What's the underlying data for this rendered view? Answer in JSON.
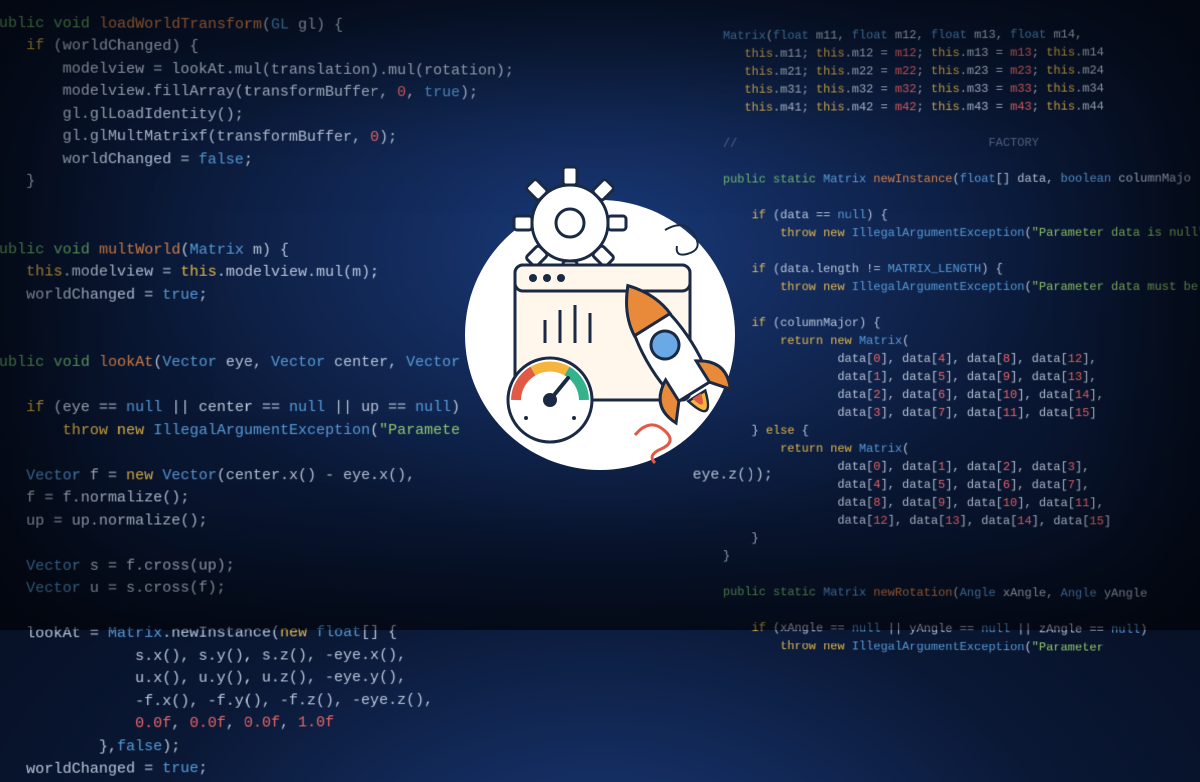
{
  "left": {
    "l1": "public void loadWorldTransform(GL gl) {",
    "l2": "    if (worldChanged) {",
    "l3": "        modelview = lookAt.mul(translation).mul(rotation);",
    "l4": "        modelview.fillArray(transformBuffer, 0, true);",
    "l5": "        gl.glLoadIdentity();",
    "l6": "        gl.glMultMatrixf(transformBuffer, 0);",
    "l7": "        worldChanged = false;",
    "l8": "    }",
    "l9": "}",
    "l10": "",
    "l11": "public void multWorld(Matrix m) {",
    "l12": "    this.modelview = this.modelview.mul(m);",
    "l13": "    worldChanged = true;",
    "l14": "}",
    "l15": "",
    "l16": "public void lookAt(Vector eye, Vector center, Vector up)",
    "l17": "",
    "l18": "    if (eye == null || center == null || up == null)",
    "l19": "        throw new IllegalArgumentException(\"Parameter",
    "l20": "",
    "l21": "    Vector f = new Vector(center.x() - eye.x(),                          eye.z());",
    "l22": "    f = f.normalize();",
    "l23": "    up = up.normalize();",
    "l24": "",
    "l25": "    Vector s = f.cross(up);",
    "l26": "    Vector u = s.cross(f);",
    "l27": "",
    "l28": "    lookAt = Matrix.newInstance(new float[] {",
    "l29": "                s.x(), s.y(), s.z(), -eye.x(),",
    "l30": "                u.x(), u.y(), u.z(), -eye.y(),",
    "l31": "                -f.x(), -f.y(), -f.z(), -eye.z(),",
    "l32": "                0.0f, 0.0f, 0.0f, 1.0f",
    "l33": "            },false);",
    "l34": "    worldChanged = true;"
  },
  "right": {
    "r1": "Matrix(float m11, float m12, float m13, float m14,",
    "r2": "       m11, m12, m13, m14,",
    "r3": "       m21, m22, m23, m24,",
    "r4": "       m31, m32, m33, m34,",
    "r5": "       m41, m42, m43, m44",
    "r6": "",
    "r7": "//                        FACTORY",
    "r8": "",
    "r9": "public static Matrix newInstance(float[] data, boolean columnMajor)",
    "r10": "",
    "r11": "    if (data == null) {",
    "r12": "        throw new IllegalArgumentException(\"Parameter data is null\");",
    "r13": "",
    "r14": "    if (data.length != MATRIX_LENGTH) {",
    "r15": "        throw new IllegalArgumentException(\"Parameter data must be\");",
    "r16": "",
    "r17": "    if (columnMajor) {",
    "r18": "        return new Matrix(",
    "r19": "                data[0], data[4], data[8], data[12],",
    "r20": "                data[1], data[5], data[9], data[13],",
    "r21": "                data[2], data[6], data[10], data[14],",
    "r22": "                data[3], data[7], data[11], data[15]",
    "r23": "    } else {",
    "r24": "        return new Matrix(",
    "r25": "                data[0], data[1], data[2], data[3],",
    "r26": "                data[4], data[5], data[6], data[7],",
    "r27": "                data[8], data[9], data[10], data[11],",
    "r28": "                data[12], data[13], data[14], data[15]",
    "r29": "    }",
    "r30": "}",
    "r31": "",
    "r32": "public static Matrix newRotation(Angle xAngle, Angle yAngle)",
    "r33": "",
    "r34": "    if (xAngle == null || yAngle == null || zAngle == null)",
    "r35": "        throw new IllegalArgumentException(\"Parameter"
  },
  "icons": {
    "gear": "gear-icon",
    "browser": "browser-window-icon",
    "gauge": "gauge-icon",
    "rocket": "rocket-icon",
    "chart": "bar-chart-icon"
  }
}
